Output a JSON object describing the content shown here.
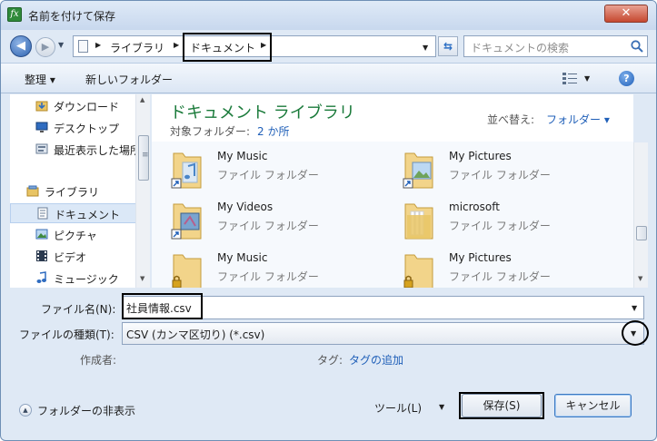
{
  "window": {
    "title": "名前を付けて保存",
    "close_label": "✕",
    "app_icon_glyph": "fx"
  },
  "address": {
    "crumbs": [
      "ライブラリ",
      "ドキュメント"
    ],
    "search_placeholder": "ドキュメントの検索"
  },
  "toolbar": {
    "organize_label": "整理 ▾",
    "new_folder_label": "新しいフォルダー",
    "help_label": "?"
  },
  "navpane": {
    "items": [
      {
        "label": "ダウンロード",
        "icon": "download-folder-icon"
      },
      {
        "label": "デスクトップ",
        "icon": "desktop-icon"
      },
      {
        "label": "最近表示した場所",
        "icon": "recent-places-icon"
      },
      {
        "label": "ライブラリ",
        "icon": "library-icon"
      },
      {
        "label": "ドキュメント",
        "icon": "document-icon",
        "selected": true
      },
      {
        "label": "ピクチャ",
        "icon": "pictures-icon"
      },
      {
        "label": "ビデオ",
        "icon": "videos-icon"
      },
      {
        "label": "ミュージック",
        "icon": "music-icon"
      }
    ]
  },
  "library": {
    "title": "ドキュメント ライブラリ",
    "target_folder_label": "対象フォルダー:",
    "target_folder_count": "2 か所",
    "sort_label": "並べ替え:",
    "sort_value": "フォルダー ▾"
  },
  "files": [
    {
      "name": "My Music",
      "type": "ファイル フォルダー",
      "overlay": "shortcut"
    },
    {
      "name": "My Pictures",
      "type": "ファイル フォルダー",
      "overlay": "shortcut"
    },
    {
      "name": "My Videos",
      "type": "ファイル フォルダー",
      "overlay": "shortcut"
    },
    {
      "name": "microsoft",
      "type": "ファイル フォルダー",
      "overlay": "none"
    },
    {
      "name": "My Music",
      "type": "ファイル フォルダー",
      "overlay": "lock"
    },
    {
      "name": "My Pictures",
      "type": "ファイル フォルダー",
      "overlay": "lock"
    }
  ],
  "form": {
    "filename_label": "ファイル名(N):",
    "filename_value": "社員情報.csv",
    "filetype_label": "ファイルの種類(T):",
    "filetype_value": "CSV (カンマ区切り) (*.csv)",
    "author_label": "作成者:",
    "tags_label": "タグ:",
    "tags_link": "タグの追加"
  },
  "footer": {
    "hide_folders_label": "フォルダーの非表示",
    "tools_label": "ツール(L)",
    "save_label": "保存(S)",
    "cancel_label": "キャンセル"
  },
  "colors": {
    "library_title": "#1a7a3a",
    "link": "#1f5fb8",
    "window_frame": "#dfe9f5"
  }
}
